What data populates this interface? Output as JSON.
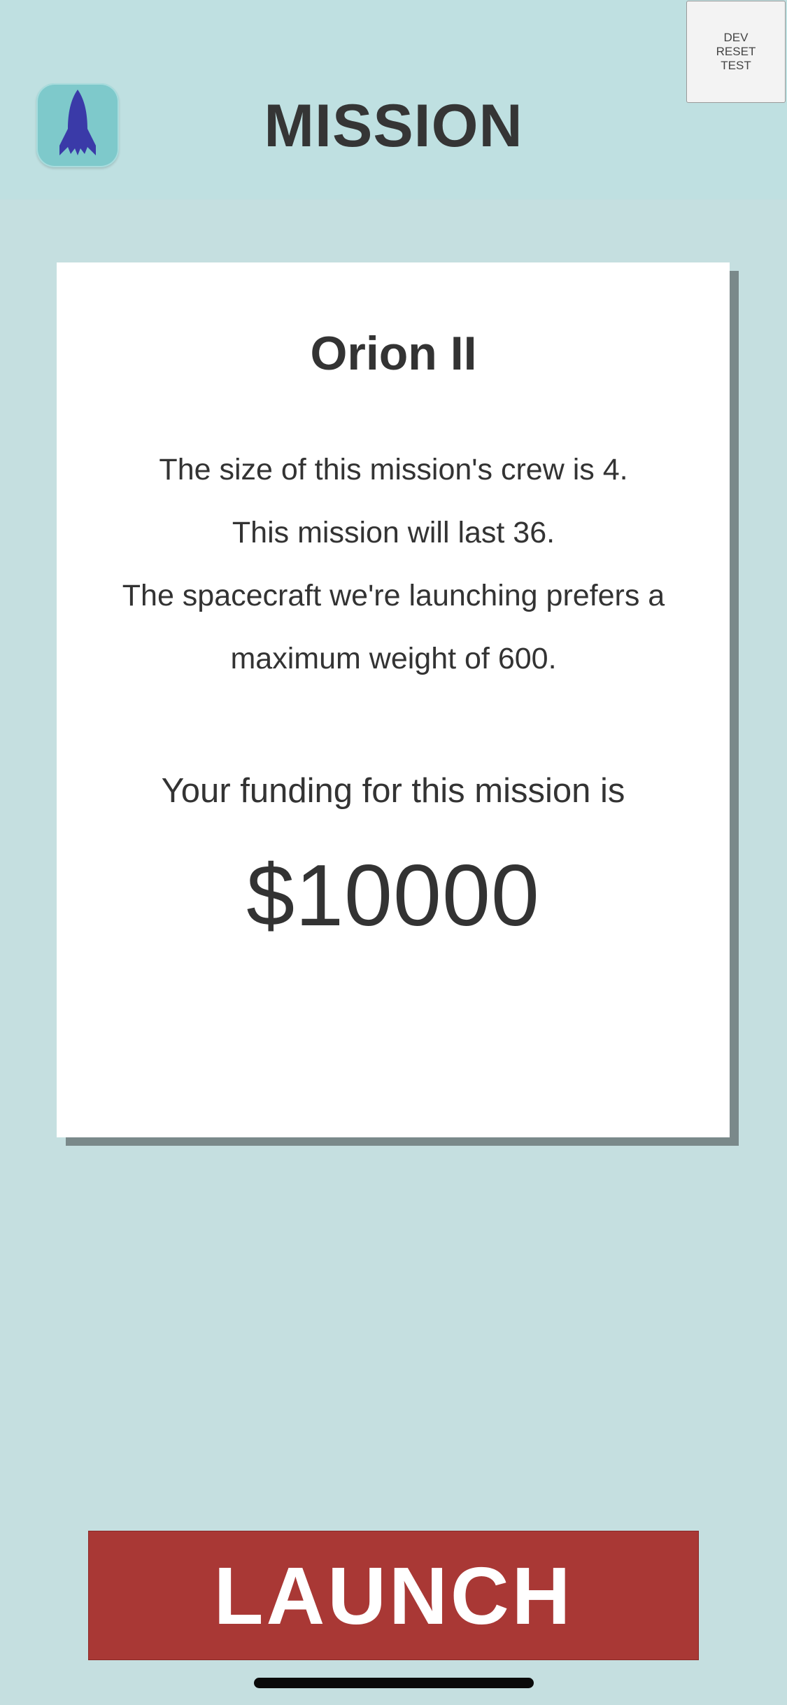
{
  "header": {
    "title": "MISSION",
    "app_icon": "rocket-icon",
    "dev_button_label": "DEV\nRESET\nTEST"
  },
  "mission": {
    "name": "Orion II",
    "details": [
      "The size of this mission's crew is 4.",
      "This mission will last 36.",
      "The spacecraft we're launching prefers a",
      "maximum weight of 600."
    ],
    "funding_label": "Your funding for this mission is",
    "funding_amount": "$10000"
  },
  "actions": {
    "launch_label": "LAUNCH"
  },
  "colors": {
    "background": "#c5dfe0",
    "header_background": "#bfe0e1",
    "card_background": "#ffffff",
    "card_shadow": "#7a898a",
    "launch_button": "#a93835",
    "rocket": "#3a3aa8",
    "icon_tile": "#7ec9cb"
  }
}
